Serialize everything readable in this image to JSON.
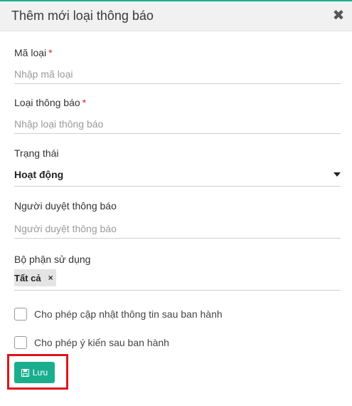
{
  "modal": {
    "title": "Thêm mới loại thông báo",
    "close_icon": "close-icon",
    "accent_color": "#1aae8f"
  },
  "fields": {
    "code": {
      "label": "Mã loại",
      "required_mark": "*",
      "placeholder": "Nhập mã loại",
      "value": ""
    },
    "type": {
      "label": "Loại thông báo",
      "required_mark": "*",
      "placeholder": "Nhập loại thông báo",
      "value": ""
    },
    "status": {
      "label": "Trạng thái",
      "selected": "Hoạt động"
    },
    "approver": {
      "label": "Người duyệt thông báo",
      "placeholder": "Người duyệt thông báo",
      "value": ""
    },
    "department": {
      "label": "Bộ phận sử dụng",
      "tags": [
        "Tất cả"
      ],
      "remove_symbol": "×"
    }
  },
  "checkboxes": {
    "allow_update": {
      "label": "Cho phép cập nhật thông tin sau ban hành",
      "checked": false
    },
    "allow_comment": {
      "label": "Cho phép ý kiến sau ban hành",
      "checked": false
    }
  },
  "actions": {
    "save_label": "Lưu",
    "save_icon": "save-icon"
  }
}
